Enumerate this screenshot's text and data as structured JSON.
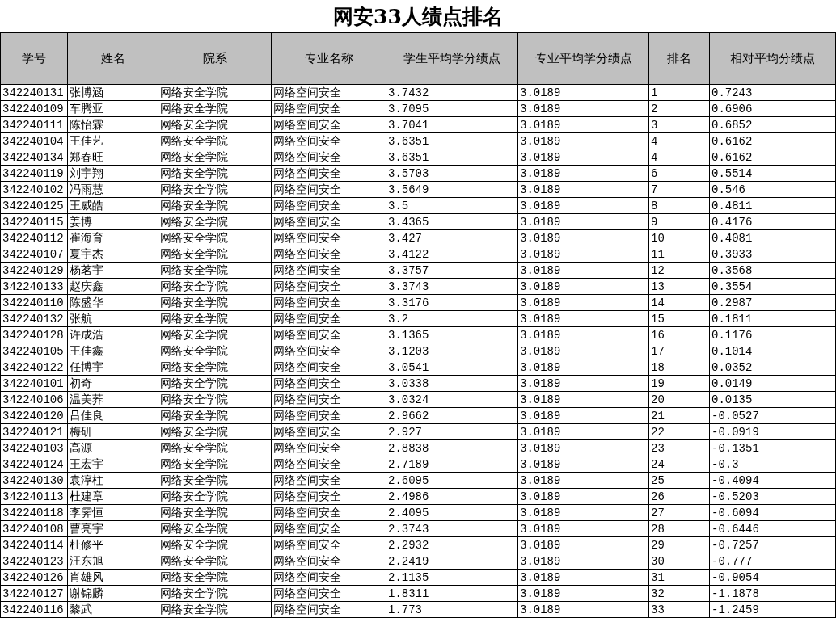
{
  "title": "网安33人绩点排名",
  "table": {
    "columns": [
      "学号",
      "姓名",
      "院系",
      "专业名称",
      "学生平均学分绩点",
      "专业平均学分绩点",
      "排名",
      "相对平均分绩点"
    ],
    "rows": [
      [
        "342240131",
        "张博涵",
        "网络安全学院",
        "网络空间安全",
        "3.7432",
        "3.0189",
        "1",
        "0.7243"
      ],
      [
        "342240109",
        "车腾亚",
        "网络安全学院",
        "网络空间安全",
        "3.7095",
        "3.0189",
        "2",
        "0.6906"
      ],
      [
        "342240111",
        "陈怡霖",
        "网络安全学院",
        "网络空间安全",
        "3.7041",
        "3.0189",
        "3",
        "0.6852"
      ],
      [
        "342240104",
        "王佳艺",
        "网络安全学院",
        "网络空间安全",
        "3.6351",
        "3.0189",
        "4",
        "0.6162"
      ],
      [
        "342240134",
        "郑春旺",
        "网络安全学院",
        "网络空间安全",
        "3.6351",
        "3.0189",
        "4",
        "0.6162"
      ],
      [
        "342240119",
        "刘宇翔",
        "网络安全学院",
        "网络空间安全",
        "3.5703",
        "3.0189",
        "6",
        "0.5514"
      ],
      [
        "342240102",
        "冯雨慧",
        "网络安全学院",
        "网络空间安全",
        "3.5649",
        "3.0189",
        "7",
        "0.546"
      ],
      [
        "342240125",
        "王威皓",
        "网络安全学院",
        "网络空间安全",
        "3.5",
        "3.0189",
        "8",
        "0.4811"
      ],
      [
        "342240115",
        "姜博",
        "网络安全学院",
        "网络空间安全",
        "3.4365",
        "3.0189",
        "9",
        "0.4176"
      ],
      [
        "342240112",
        "崔海育",
        "网络安全学院",
        "网络空间安全",
        "3.427",
        "3.0189",
        "10",
        "0.4081"
      ],
      [
        "342240107",
        "夏宇杰",
        "网络安全学院",
        "网络空间安全",
        "3.4122",
        "3.0189",
        "11",
        "0.3933"
      ],
      [
        "342240129",
        "杨茗宇",
        "网络安全学院",
        "网络空间安全",
        "3.3757",
        "3.0189",
        "12",
        "0.3568"
      ],
      [
        "342240133",
        "赵庆鑫",
        "网络安全学院",
        "网络空间安全",
        "3.3743",
        "3.0189",
        "13",
        "0.3554"
      ],
      [
        "342240110",
        "陈盛华",
        "网络安全学院",
        "网络空间安全",
        "3.3176",
        "3.0189",
        "14",
        "0.2987"
      ],
      [
        "342240132",
        "张航",
        "网络安全学院",
        "网络空间安全",
        "3.2",
        "3.0189",
        "15",
        "0.1811"
      ],
      [
        "342240128",
        "许成浩",
        "网络安全学院",
        "网络空间安全",
        "3.1365",
        "3.0189",
        "16",
        "0.1176"
      ],
      [
        "342240105",
        "王佳鑫",
        "网络安全学院",
        "网络空间安全",
        "3.1203",
        "3.0189",
        "17",
        "0.1014"
      ],
      [
        "342240122",
        "任博宇",
        "网络安全学院",
        "网络空间安全",
        "3.0541",
        "3.0189",
        "18",
        "0.0352"
      ],
      [
        "342240101",
        "初奇",
        "网络安全学院",
        "网络空间安全",
        "3.0338",
        "3.0189",
        "19",
        "0.0149"
      ],
      [
        "342240106",
        "温美荞",
        "网络安全学院",
        "网络空间安全",
        "3.0324",
        "3.0189",
        "20",
        "0.0135"
      ],
      [
        "342240120",
        "吕佳良",
        "网络安全学院",
        "网络空间安全",
        "2.9662",
        "3.0189",
        "21",
        "-0.0527"
      ],
      [
        "342240121",
        "梅研",
        "网络安全学院",
        "网络空间安全",
        "2.927",
        "3.0189",
        "22",
        "-0.0919"
      ],
      [
        "342240103",
        "高源",
        "网络安全学院",
        "网络空间安全",
        "2.8838",
        "3.0189",
        "23",
        "-0.1351"
      ],
      [
        "342240124",
        "王宏宇",
        "网络安全学院",
        "网络空间安全",
        "2.7189",
        "3.0189",
        "24",
        "-0.3"
      ],
      [
        "342240130",
        "袁淳柱",
        "网络安全学院",
        "网络空间安全",
        "2.6095",
        "3.0189",
        "25",
        "-0.4094"
      ],
      [
        "342240113",
        "杜建章",
        "网络安全学院",
        "网络空间安全",
        "2.4986",
        "3.0189",
        "26",
        "-0.5203"
      ],
      [
        "342240118",
        "李霁恒",
        "网络安全学院",
        "网络空间安全",
        "2.4095",
        "3.0189",
        "27",
        "-0.6094"
      ],
      [
        "342240108",
        "曹亮宇",
        "网络安全学院",
        "网络空间安全",
        "2.3743",
        "3.0189",
        "28",
        "-0.6446"
      ],
      [
        "342240114",
        "杜修平",
        "网络安全学院",
        "网络空间安全",
        "2.2932",
        "3.0189",
        "29",
        "-0.7257"
      ],
      [
        "342240123",
        "汪东旭",
        "网络安全学院",
        "网络空间安全",
        "2.2419",
        "3.0189",
        "30",
        "-0.777"
      ],
      [
        "342240126",
        "肖雄风",
        "网络安全学院",
        "网络空间安全",
        "2.1135",
        "3.0189",
        "31",
        "-0.9054"
      ],
      [
        "342240127",
        "谢锦麟",
        "网络安全学院",
        "网络空间安全",
        "1.8311",
        "3.0189",
        "32",
        "-1.1878"
      ],
      [
        "342240116",
        "黎武",
        "网络安全学院",
        "网络空间安全",
        "1.773",
        "3.0189",
        "33",
        "-1.2459"
      ]
    ]
  }
}
